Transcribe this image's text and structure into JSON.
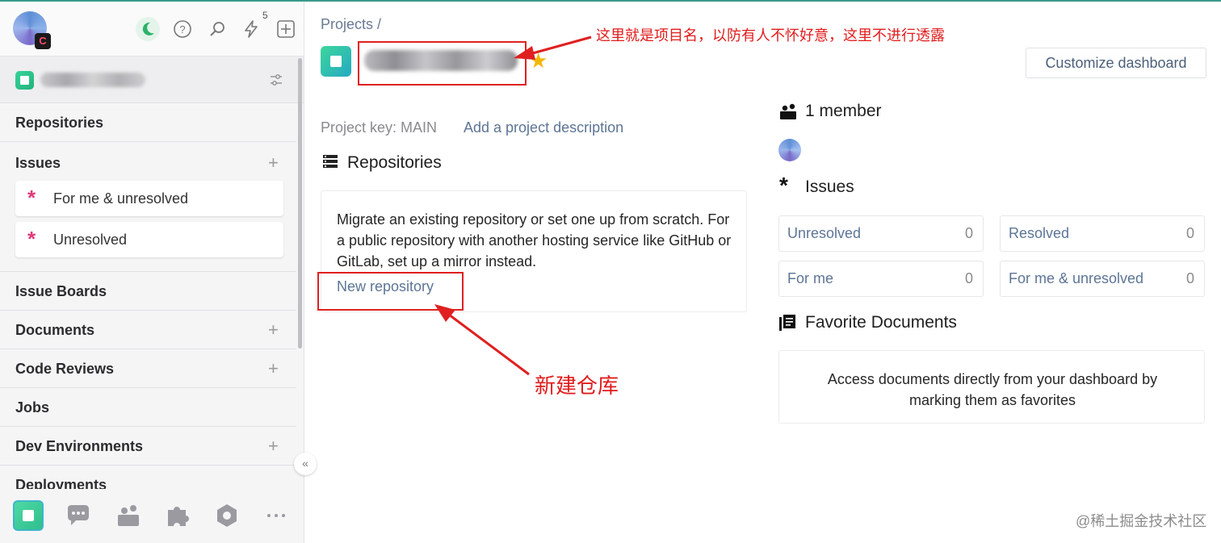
{
  "colors": {
    "accent": "#5d7596",
    "issue_star": "#e03a77",
    "favorite_star": "#f2b705",
    "annotation": "#e02020"
  },
  "top_bar": {
    "notification_count": "5",
    "user_badge": "C"
  },
  "sidebar": {
    "nav": {
      "repositories": "Repositories",
      "issues": "Issues",
      "issue_filters": [
        "For me & unresolved",
        "Unresolved"
      ],
      "issue_boards": "Issue Boards",
      "documents": "Documents",
      "code_reviews": "Code Reviews",
      "jobs": "Jobs",
      "dev_environments": "Dev Environments",
      "deployments": "Deployments"
    },
    "bottom_icons": [
      "project-icon",
      "chat-icon",
      "team-icon",
      "extensions-icon",
      "settings-hexagon-icon",
      "more-icon"
    ]
  },
  "main": {
    "breadcrumb": "Projects /",
    "customize_label": "Customize dashboard",
    "project_key": "Project key: MAIN",
    "add_description": "Add a project description",
    "repositories": {
      "heading": "Repositories",
      "description": "Migrate an existing repository or set one up from scratch. For a public repository with another hosting service like GitHub or GitLab, set up a mirror instead.",
      "new_repo_label": "New repository"
    },
    "members": {
      "label": "1 member"
    },
    "issues": {
      "heading": "Issues",
      "stats": [
        {
          "label": "Unresolved",
          "count": "0"
        },
        {
          "label": "Resolved",
          "count": "0"
        },
        {
          "label": "For me",
          "count": "0"
        },
        {
          "label": "For me & unresolved",
          "count": "0"
        }
      ]
    },
    "favorites": {
      "heading": "Favorite Documents",
      "empty_text": "Access documents directly from your dashboard by marking them as favorites"
    }
  },
  "annotations": {
    "project_name_note": "这里就是项目名，以防有人不怀好意，这里不进行透露",
    "new_repo_note": "新建仓库"
  },
  "watermark": "@稀土掘金技术社区"
}
